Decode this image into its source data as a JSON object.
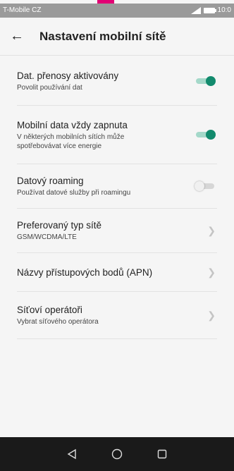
{
  "status_bar": {
    "carrier": "T-Mobile CZ",
    "time": "10:0"
  },
  "header": {
    "title": "Nastavení mobilní sítě"
  },
  "settings": [
    {
      "title": "Dat. přenosy aktivovány",
      "subtitle": "Povolit používání dat",
      "control": "toggle",
      "on": true
    },
    {
      "title": "Mobilní data vždy zapnuta",
      "subtitle": "V některých mobilních sítích může spotřebovávat více energie",
      "control": "toggle",
      "on": true
    },
    {
      "title": "Datový roaming",
      "subtitle": "Používat datové služby při roamingu",
      "control": "toggle",
      "on": false
    },
    {
      "title": "Preferovaný typ sítě",
      "subtitle": "GSM/WCDMA/LTE",
      "control": "chevron"
    },
    {
      "title": "Názvy přístupových bodů (APN)",
      "control": "chevron"
    },
    {
      "title": "Síťoví operátoři",
      "subtitle": "Vybrat síťového operátora",
      "control": "chevron"
    }
  ],
  "icons": {
    "back": "arrow-left-icon",
    "chevron": "chevron-right-icon",
    "nav_back": "triangle-back-icon",
    "nav_home": "circle-home-icon",
    "nav_recents": "square-recents-icon"
  },
  "colors": {
    "accent": "#128a6d",
    "accent_track": "#a4d8c9",
    "brand": "#e20074",
    "status_bar": "#9a9a9a",
    "nav_bar": "#1a1a1a"
  }
}
